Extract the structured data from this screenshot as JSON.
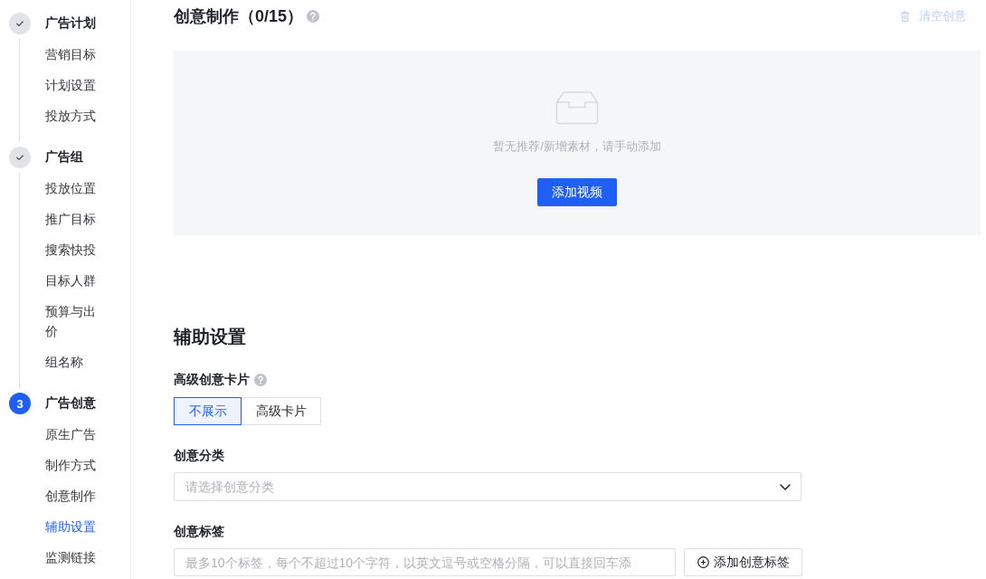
{
  "sidebar": {
    "steps": [
      {
        "kind": "done",
        "title": "广告计划",
        "items": [
          {
            "label": "营销目标",
            "selected": false
          },
          {
            "label": "计划设置",
            "selected": false
          },
          {
            "label": "投放方式",
            "selected": false
          }
        ]
      },
      {
        "kind": "done",
        "title": "广告组",
        "items": [
          {
            "label": "投放位置",
            "selected": false
          },
          {
            "label": "推广目标",
            "selected": false
          },
          {
            "label": "搜索快投",
            "selected": false
          },
          {
            "label": "目标人群",
            "selected": false
          },
          {
            "label": "预算与出价",
            "selected": false
          },
          {
            "label": "组名称",
            "selected": false
          }
        ]
      },
      {
        "kind": "current",
        "number": "3",
        "title": "广告创意",
        "items": [
          {
            "label": "原生广告",
            "selected": false
          },
          {
            "label": "制作方式",
            "selected": false
          },
          {
            "label": "创意制作",
            "selected": false
          },
          {
            "label": "辅助设置",
            "selected": true
          },
          {
            "label": "监测链接",
            "selected": false
          }
        ]
      }
    ]
  },
  "creative": {
    "title": "创意制作（0/15）",
    "clear_button": {
      "label": "清空创意",
      "disabled": true
    },
    "empty_state": {
      "message": "暂无推荐/新增素材，请手动添加",
      "button": "添加视频"
    }
  },
  "settings": {
    "title": "辅助设置",
    "card": {
      "label": "高级创意卡片",
      "options": [
        {
          "label": "不展示",
          "selected": true
        },
        {
          "label": "高级卡片",
          "selected": false
        }
      ]
    },
    "category": {
      "label": "创意分类",
      "placeholder": "请选择创意分类"
    },
    "tags": {
      "label": "创意标签",
      "placeholder": "最多10个标签，每个不超过10个字符，以英文逗号或空格分隔，可以直接回车添",
      "button": "添加创意标签"
    }
  }
}
